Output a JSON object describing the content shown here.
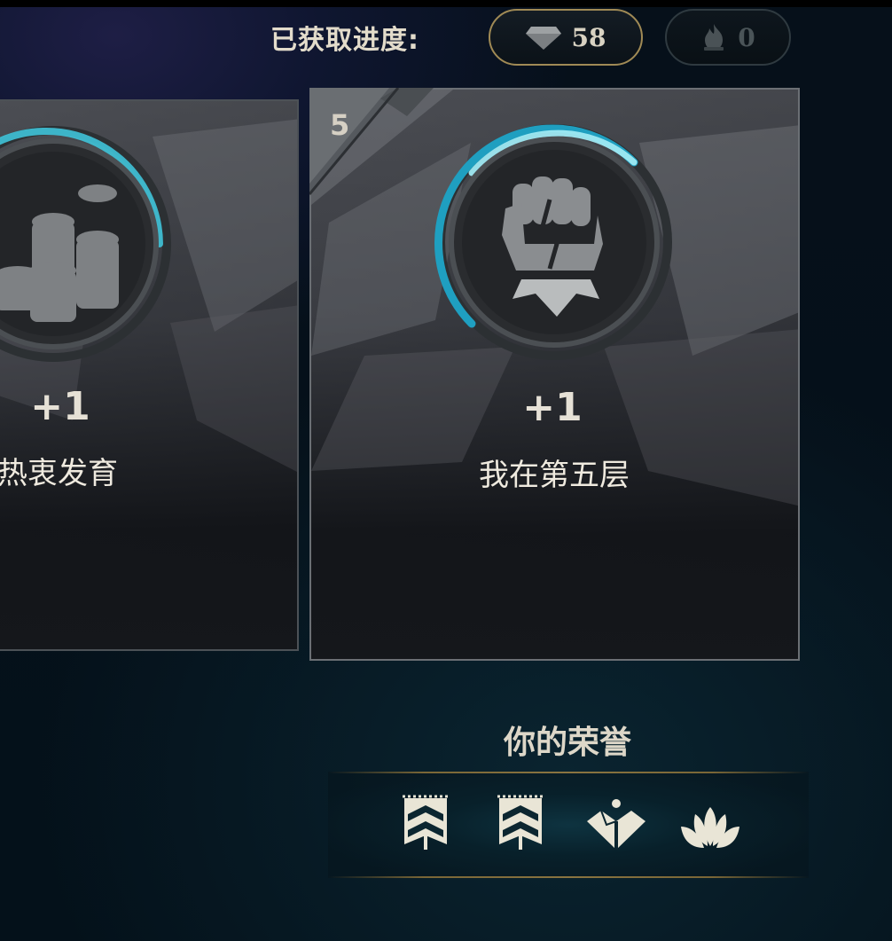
{
  "progress": {
    "label": "已获取进度:",
    "gem": {
      "icon": "gem-icon",
      "value": "58"
    },
    "flame": {
      "icon": "flame-icon",
      "value": "0"
    }
  },
  "cards": [
    {
      "id": "left",
      "icon": "coin-stacks-icon",
      "points": "+1",
      "title": "热衷发育",
      "progress_fraction": 0.3
    },
    {
      "id": "right",
      "rank": "5",
      "icon": "fist-icon",
      "points": "+1",
      "title": "我在第五层",
      "progress_fraction": 0.45
    }
  ],
  "honors": {
    "title": "你的荣誉",
    "icons": [
      "chevron-banner-icon",
      "chevron-banner-icon",
      "heart-diamond-icon",
      "lotus-icon"
    ]
  },
  "colors": {
    "accent_cyan": "#3fc3d8",
    "gold_border": "#a08a55",
    "text_light": "#efeadf"
  }
}
